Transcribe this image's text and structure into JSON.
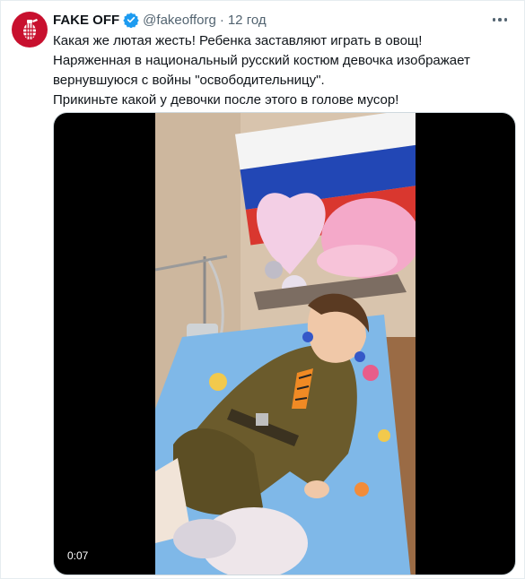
{
  "account": {
    "name": "FAKE OFF",
    "handle": "@fakeofforg",
    "separator": "·",
    "time": "12 год"
  },
  "tweet": {
    "lines": [
      "Какая же лютая жесть! Ребенка заставляют играть в овощ!",
      "Наряженная в национальный русский костюм девочка изображает",
      "вернувшуюся с войны \"освободительницу\".",
      "Прикиньте какой у девочки после этого в голове мусор!"
    ]
  },
  "media": {
    "duration": "0:07"
  },
  "icons": {
    "avatar": "grenade-logo-icon",
    "verified": "verified-badge-icon",
    "more": "more-options-icon"
  },
  "colors": {
    "brand_red": "#c8102e",
    "verified_blue": "#1d9bf0",
    "secondary_text": "#536471"
  }
}
